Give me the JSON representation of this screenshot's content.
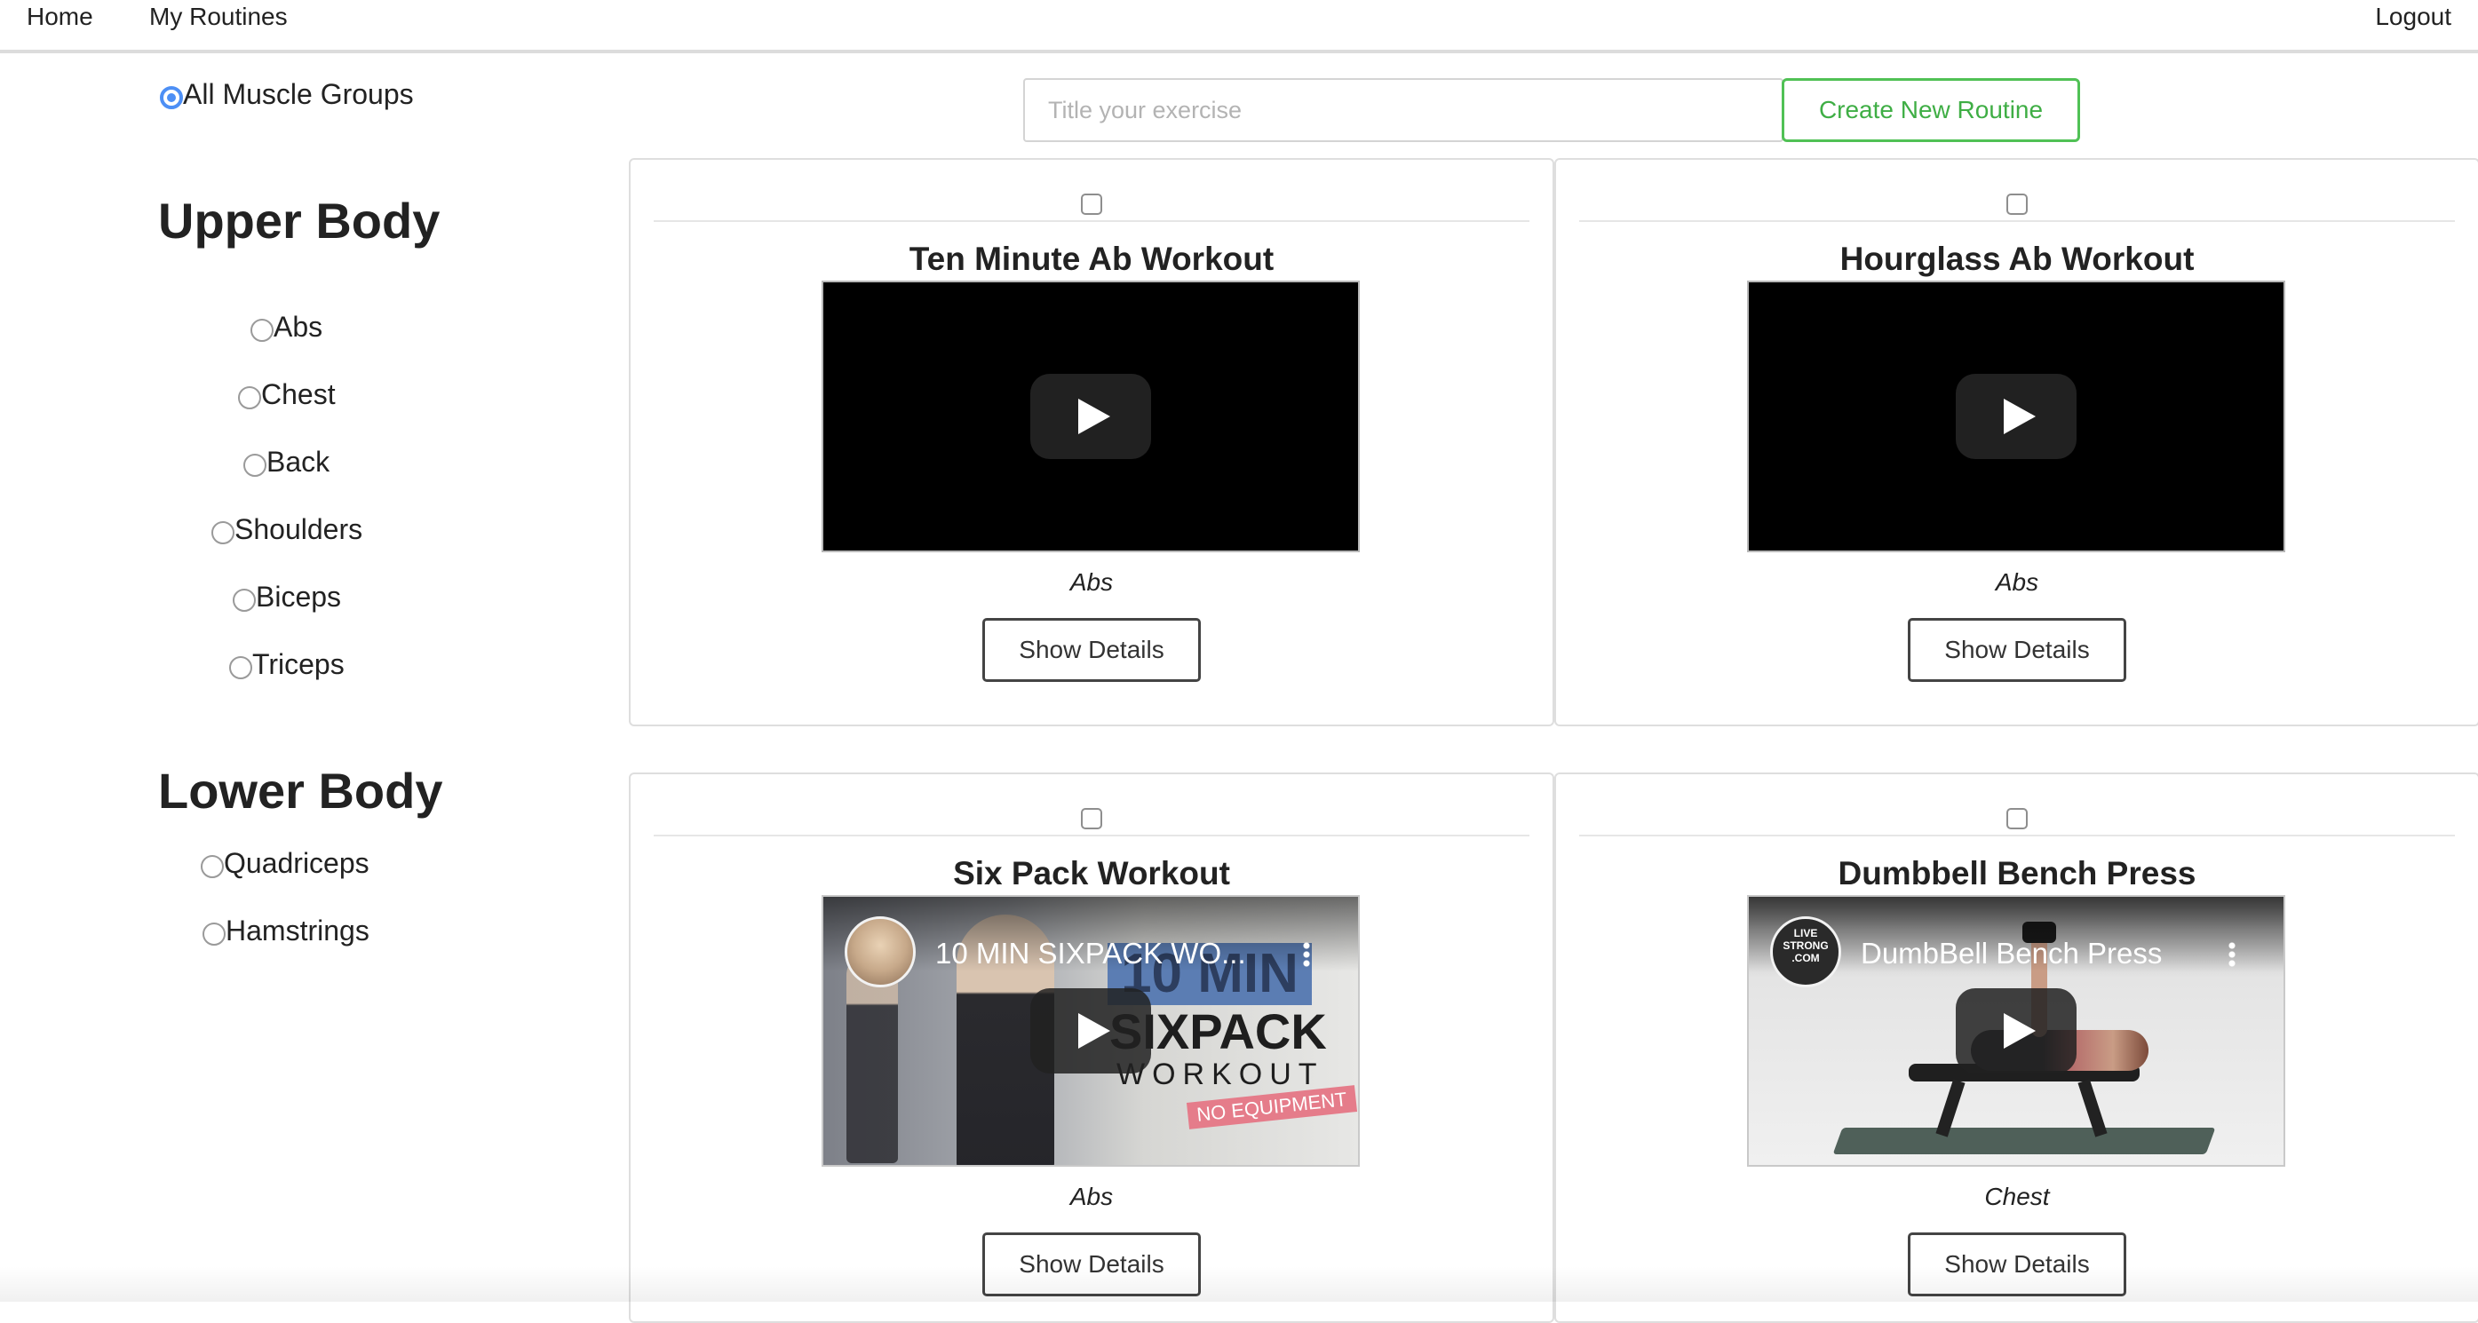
{
  "nav": {
    "home": "Home",
    "my_routines": "My Routines",
    "logout": "Logout"
  },
  "sidebar": {
    "all_label": "All Muscle Groups",
    "selected": "All Muscle Groups",
    "upper_heading": "Upper Body",
    "upper_items": [
      "Abs",
      "Chest",
      "Back",
      "Shoulders",
      "Biceps",
      "Triceps"
    ],
    "lower_heading": "Lower Body",
    "lower_items": [
      "Quadriceps",
      "Hamstrings"
    ]
  },
  "toolbar": {
    "title_placeholder": "Title your exercise",
    "title_value": "",
    "create_label": "Create New Routine"
  },
  "exercises": [
    {
      "title": "Ten Minute Ab Workout",
      "category": "Abs",
      "details_label": "Show Details",
      "video_thumb_title": ""
    },
    {
      "title": "Hourglass Ab Workout",
      "category": "Abs",
      "details_label": "Show Details",
      "video_thumb_title": ""
    },
    {
      "title": "Six Pack Workout",
      "category": "Abs",
      "details_label": "Show Details",
      "video_thumb_title": "10 MIN SIXPACK WO...",
      "thumb_text": {
        "big1": "10 MIN",
        "big2": "SIXPACK",
        "big3": "WORKOUT",
        "tag": "NO EQUIPMENT"
      }
    },
    {
      "title": "Dumbbell Bench Press",
      "category": "Chest",
      "details_label": "Show Details",
      "video_thumb_title": "DumbBell Bench Press",
      "thumb_text": {
        "logo": "LIVE STRONG .COM"
      }
    }
  ],
  "colors": {
    "accent_green": "#50c155",
    "radio_blue": "#4d8ff5"
  },
  "icons": {
    "play": "play-icon",
    "menu": "kebab-menu-icon"
  }
}
